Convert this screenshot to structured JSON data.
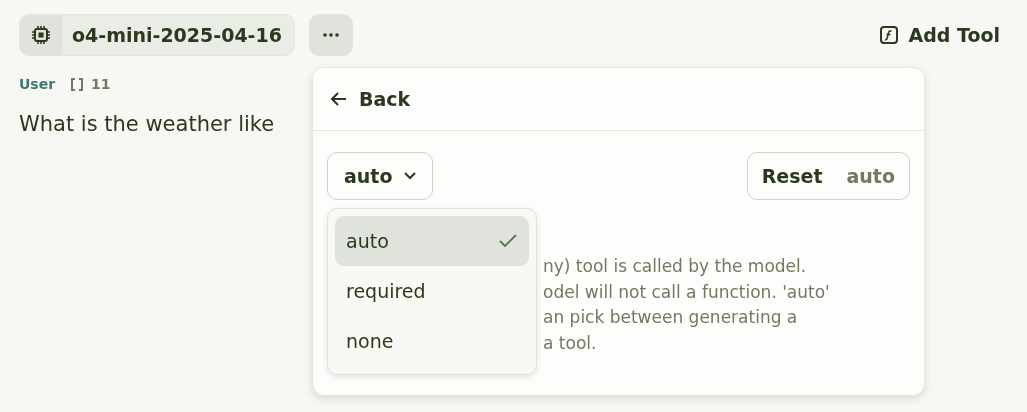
{
  "toolbar": {
    "model": "o4-mini-2025-04-16",
    "add_tool": "Add Tool"
  },
  "message": {
    "role": "User",
    "token_count": "11",
    "text": "What is the weather like"
  },
  "popover": {
    "back": "Back",
    "select": {
      "value": "auto",
      "expanded": true
    },
    "reset": {
      "label": "Reset",
      "value": "auto"
    },
    "options": [
      {
        "label": "auto",
        "selected": true
      },
      {
        "label": "required",
        "selected": false
      },
      {
        "label": "none",
        "selected": false
      }
    ],
    "description_lines": [
      "ny) tool is called by the model.",
      "odel will not call a function. 'auto'",
      "an pick between generating a",
      "a tool."
    ]
  }
}
